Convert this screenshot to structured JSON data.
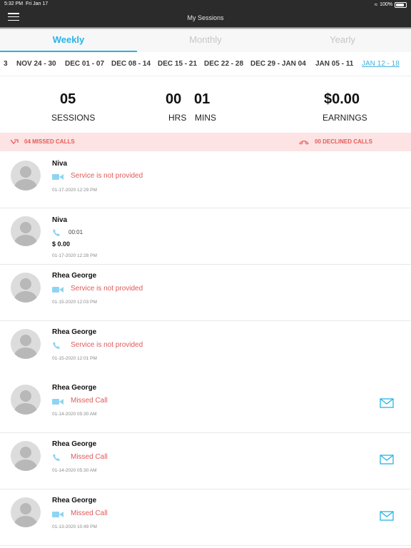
{
  "status_bar": {
    "time": "5:32 PM",
    "date": "Fri Jan 17",
    "battery": "100%",
    "wifi_icon": "wifi-icon",
    "battery_icon": "battery-icon"
  },
  "nav": {
    "title": "My Sessions",
    "menu_icon": "hamburger-menu-icon"
  },
  "period_tabs": [
    {
      "label": "Weekly",
      "active": true
    },
    {
      "label": "Monthly",
      "active": false
    },
    {
      "label": "Yearly",
      "active": false
    }
  ],
  "ranges": [
    {
      "label": "3",
      "active": false
    },
    {
      "label": "NOV 24 - 30",
      "active": false
    },
    {
      "label": "DEC 01 - 07",
      "active": false
    },
    {
      "label": "DEC 08 - 14",
      "active": false
    },
    {
      "label": "DEC 15 - 21",
      "active": false
    },
    {
      "label": "DEC 22 - 28",
      "active": false
    },
    {
      "label": "DEC 29 - JAN 04",
      "active": false
    },
    {
      "label": "JAN 05 - 11",
      "active": false
    },
    {
      "label": "JAN 12 - 18",
      "active": true
    }
  ],
  "summary": {
    "sessions_value": "05",
    "sessions_label": "SESSIONS",
    "hrs_value": "00",
    "hrs_label": "HRS",
    "mins_value": "01",
    "mins_label": "MINS",
    "earnings_value": "$0.00",
    "earnings_label": "EARNINGS"
  },
  "calls": {
    "missed_label": "04 MISSED CALLS",
    "declined_label": "00 DECLINED CALLS"
  },
  "sessions": [
    {
      "name": "Niva",
      "type": "video",
      "status": "Service is not provided",
      "timestamp": "01-17-2020 12:29 PM",
      "mail": false
    },
    {
      "name": "Niva",
      "type": "phone",
      "duration": "00:01",
      "amount": "$ 0.00",
      "timestamp": "01-17-2020 12:28 PM",
      "mail": false
    },
    {
      "name": "Rhea George",
      "type": "video",
      "status": "Service is not provided",
      "timestamp": "01-15-2020 12:03 PM",
      "mail": false
    },
    {
      "name": "Rhea George",
      "type": "phone",
      "status": "Service is not provided",
      "timestamp": "01-15-2020 12:01 PM",
      "mail": false
    },
    {
      "name": "Rhea George",
      "type": "video",
      "status": "Missed Call",
      "timestamp": "01-14-2020 05:30 AM",
      "mail": true
    },
    {
      "name": "Rhea George",
      "type": "phone",
      "status": "Missed Call",
      "timestamp": "01-14-2020 05:30 AM",
      "mail": true
    },
    {
      "name": "Rhea George",
      "type": "video",
      "status": "Missed Call",
      "timestamp": "01-13-2020 10:49 PM",
      "mail": true
    }
  ],
  "colors": {
    "accent": "#27b3e6",
    "missed": "#e25858",
    "missed_bg": "#fde3e3",
    "nav_bg": "#2b2b2b"
  }
}
